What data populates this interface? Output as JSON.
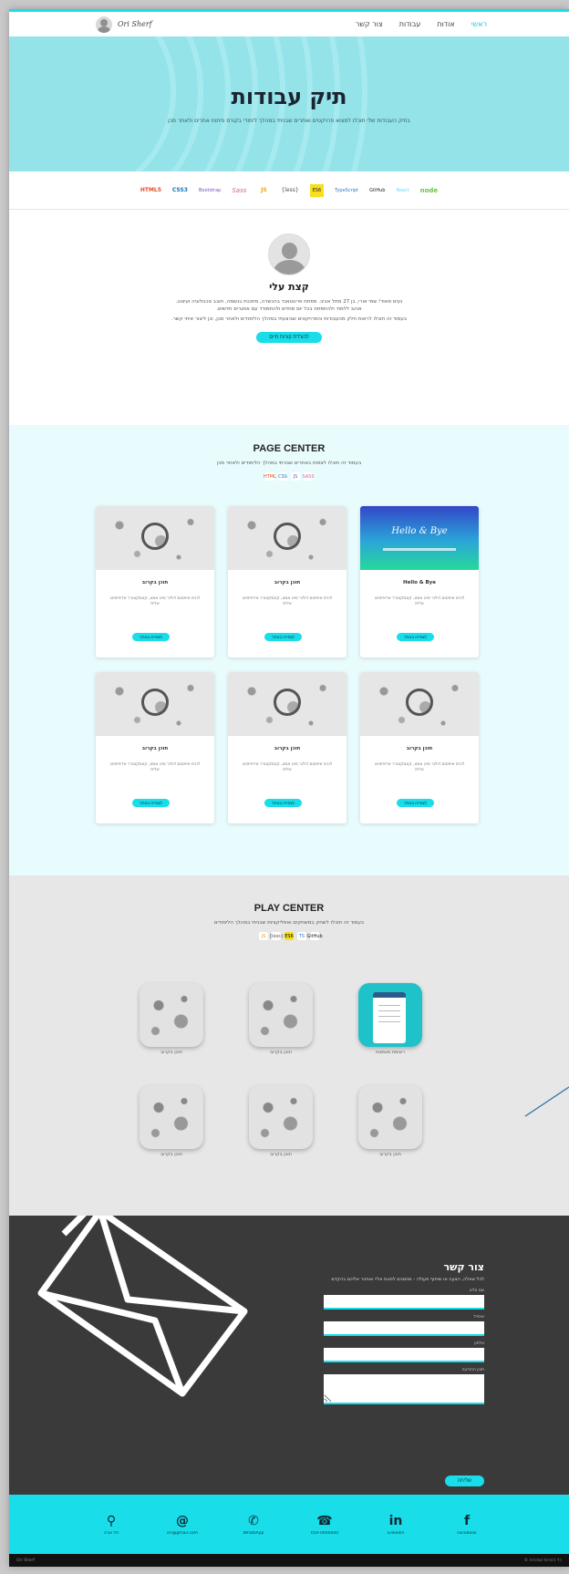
{
  "nav": {
    "logo": "Ori Sherf",
    "links": [
      "ראשי",
      "אודות",
      "עבודות",
      "צור קשר"
    ],
    "active_index": 0
  },
  "hero": {
    "title": "תיק עבודות",
    "subtitle": "בתיק העבודות שלי תוכלו למצוא פרויקטים ואתרים שבניתי במהלך לימודי בקורס פיתוח אתרים ולאחר מכן"
  },
  "tech_logos": [
    "HTML5",
    "CSS3",
    "Bootstrap",
    "Sass",
    "JS",
    "{less}",
    "ES6",
    "TypeScript",
    "GitHub",
    "React",
    "node"
  ],
  "about": {
    "title": "קצת עלי",
    "paragraph1": "נעים מאוד! שמי אורי, בן 27 מתל אביב. מפתח פרונטאנד בהכשרה, מתכנת בנשמה, חובב טכנולוגיה ועיצוב. אוהב ללמוד ולהתפתח בכל יום מחדש ולהתמודד עם אתגרים חדשים.",
    "paragraph2": "בעמוד זה תוכלו לראות חלק מהעבודות והפרויקטים שביצעתי במהלך הלימודים ולאחר מכן, וכן ליצור איתי קשר.",
    "button": "להורדת קורות חיים"
  },
  "page_center": {
    "title": "PAGE CENTER",
    "subtitle": "בעמוד זה תוכלו לצפות באתרים שבניתי במהלך הלימודים ולאחר מכן",
    "tech": [
      "HTML",
      "CSS",
      "JS",
      "SASS"
    ],
    "cards": [
      {
        "title": "תוכן בקרוב",
        "image": "doodle",
        "desc": "לורם איפסום דולור סיט אמט, קונסקטורר אדיפיסינג אלית",
        "button": "לצפייה באתר"
      },
      {
        "title": "תוכן בקרוב",
        "image": "doodle",
        "desc": "לורם איפסום דולור סיט אמט, קונסקטורר אדיפיסינג אלית",
        "button": "לצפייה באתר"
      },
      {
        "title": "Hello & Bye",
        "image": "hello",
        "image_text": "Hello & Bye",
        "desc": "לורם איפסום דולור סיט אמט, קונסקטורר אדיפיסינג אלית",
        "button": "לצפייה באתר"
      },
      {
        "title": "תוכן בקרוב",
        "image": "doodle",
        "desc": "לורם איפסום דולור סיט אמט, קונסקטורר אדיפיסינג אלית",
        "button": "לצפייה באתר"
      },
      {
        "title": "תוכן בקרוב",
        "image": "doodle",
        "desc": "לורם איפסום דולור סיט אמט, קונסקטורר אדיפיסינג אלית",
        "button": "לצפייה באתר"
      },
      {
        "title": "תוכן בקרוב",
        "image": "doodle",
        "desc": "לורם איפסום דולור סיט אמט, קונסקטורר אדיפיסינג אלית",
        "button": "לצפייה באתר"
      }
    ]
  },
  "play_center": {
    "title": "PLAY CENTER",
    "subtitle": "בעמוד זה תוכלו לשחק במשחקים ואפליקציות שבניתי במהלך הלימודים",
    "tech": [
      "JS",
      "{less}",
      "ES6",
      "TS",
      "GitHub"
    ],
    "items": [
      {
        "label": "תוכן בקרוב",
        "icon": "doodle"
      },
      {
        "label": "תוכן בקרוב",
        "icon": "doodle"
      },
      {
        "label": "רשימת משימות",
        "icon": "todo"
      },
      {
        "label": "תוכן בקרוב",
        "icon": "doodle"
      },
      {
        "label": "תוכן בקרוב",
        "icon": "doodle"
      },
      {
        "label": "תוכן בקרוב",
        "icon": "doodle"
      }
    ]
  },
  "contact": {
    "title": "צור קשר",
    "intro": "לכל שאלה, הצעה או שיתוף פעולה - מוזמנים לפנות אליי ואחזור אליכם בהקדם",
    "fields": [
      "שם מלא",
      "אימייל",
      "טלפון",
      "תוכן ההודעה"
    ],
    "submit": "שליחה"
  },
  "footer": {
    "items": [
      {
        "icon": "location-icon",
        "glyph": "⚲",
        "label": "תל אביב"
      },
      {
        "icon": "at-icon",
        "glyph": "@",
        "label": "ori@gmail.com"
      },
      {
        "icon": "whatsapp-icon",
        "glyph": "✆",
        "label": "WhatsApp"
      },
      {
        "icon": "phone-icon",
        "glyph": "☎",
        "label": "050-0000000"
      },
      {
        "icon": "linkedin-icon",
        "glyph": "in",
        "label": "LinkedIn"
      },
      {
        "icon": "facebook-icon",
        "glyph": "f",
        "label": "Facebook"
      }
    ]
  },
  "bottom_bar": {
    "left": "Ori Sherf",
    "right": "© כל הזכויות שמורות"
  },
  "colors": {
    "accent": "#19dde8",
    "hero_bg": "#93e3e9",
    "page_center_bg": "#e9fcfd",
    "play_center_bg": "#e7e7e7",
    "contact_bg": "#3a3a3a"
  }
}
